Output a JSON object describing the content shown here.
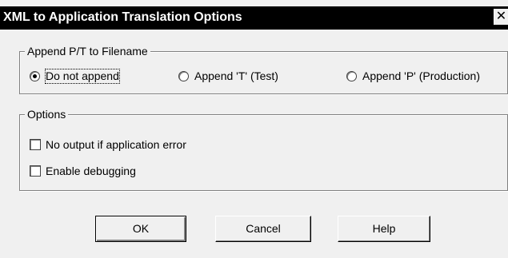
{
  "window": {
    "title": "XML to Application Translation Options",
    "close_glyph": "✕"
  },
  "append_group": {
    "label": "Append P/T to Filename",
    "options": [
      {
        "label": "Do not append",
        "selected": true
      },
      {
        "label": "Append 'T' (Test)",
        "selected": false
      },
      {
        "label": "Append 'P' (Production)",
        "selected": false
      }
    ]
  },
  "options_group": {
    "label": "Options",
    "checkboxes": [
      {
        "label": "No output if application error",
        "checked": false
      },
      {
        "label": "Enable debugging",
        "checked": false
      }
    ]
  },
  "buttons": {
    "ok": "OK",
    "cancel": "Cancel",
    "help": "Help"
  },
  "colors": {
    "title_bg": "#000000",
    "title_fg": "#ffffff",
    "dialog_bg": "#f0f0f0"
  }
}
